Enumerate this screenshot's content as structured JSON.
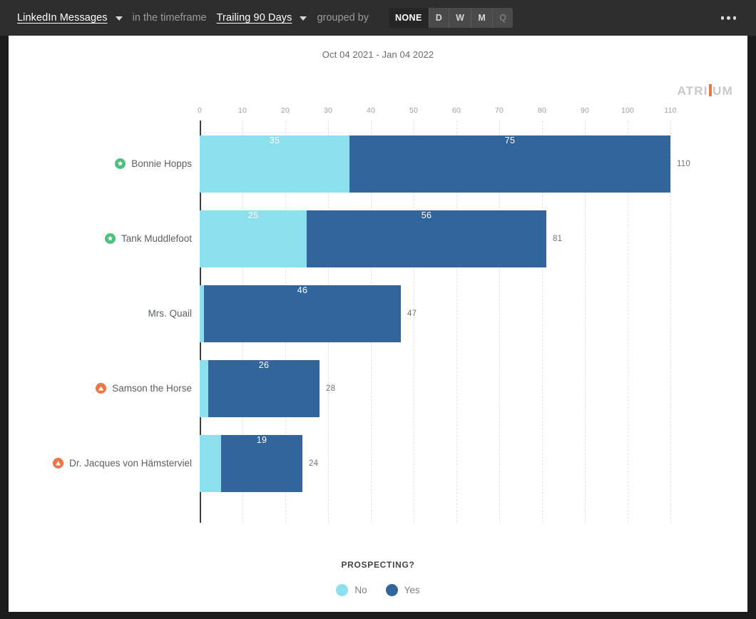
{
  "toolbar": {
    "metric_label": "LinkedIn Messages",
    "metric_caret": "chevron-down-icon",
    "timeframe_prefix": "in the timeframe",
    "timeframe_label": "Trailing 90 Days",
    "timeframe_caret": "chevron-down-icon",
    "grouped_by_label": "grouped by",
    "group_options": [
      {
        "label": "NONE",
        "state": "active"
      },
      {
        "label": "D",
        "state": "normal"
      },
      {
        "label": "W",
        "state": "normal"
      },
      {
        "label": "M",
        "state": "normal"
      },
      {
        "label": "Q",
        "state": "disabled"
      }
    ],
    "more_icon": "ellipsis-icon"
  },
  "card": {
    "title": "Oct 04 2021 - Jan 04 2022",
    "brand_left": "ATRI",
    "brand_right": "UM"
  },
  "legend": {
    "title": "PROSPECTING?",
    "items": [
      {
        "label": "No",
        "color": "#8ce0ed"
      },
      {
        "label": "Yes",
        "color": "#32659b"
      }
    ]
  },
  "colors": {
    "no": "#8ce0ed",
    "yes": "#32659b",
    "toolbar_bg": "#2e2e2e",
    "window_bg": "#1c1c1c",
    "badge_green": "#4ec07e",
    "badge_orange": "#ef7542",
    "brand_accent": "#ef7548"
  },
  "chart_data": {
    "type": "bar",
    "orientation": "horizontal",
    "stacked": true,
    "title": "Oct 04 2021 - Jan 04 2022",
    "xlabel": "",
    "ylabel": "",
    "xlim": [
      0,
      110
    ],
    "xticks": [
      0,
      10,
      20,
      30,
      40,
      50,
      60,
      70,
      80,
      90,
      100,
      110
    ],
    "grid": true,
    "legend_title": "PROSPECTING?",
    "legend_position": "bottom",
    "categories": [
      "Bonnie Hopps",
      "Tank Muddlefoot",
      "Mrs. Quail",
      "Samson the Horse",
      "Dr. Jacques von Hämsterviel"
    ],
    "category_badges": [
      "green",
      "green",
      "none",
      "orange",
      "orange"
    ],
    "series": [
      {
        "name": "No",
        "color": "#8ce0ed",
        "values": [
          35,
          25,
          1,
          2,
          5
        ]
      },
      {
        "name": "Yes",
        "color": "#32659b",
        "values": [
          75,
          56,
          46,
          26,
          19
        ]
      }
    ],
    "totals": [
      110,
      81,
      47,
      28,
      24
    ],
    "value_labels": {
      "no": [
        "35",
        "25",
        "",
        "",
        ""
      ],
      "yes": [
        "75",
        "56",
        "46",
        "26",
        "19"
      ]
    }
  }
}
